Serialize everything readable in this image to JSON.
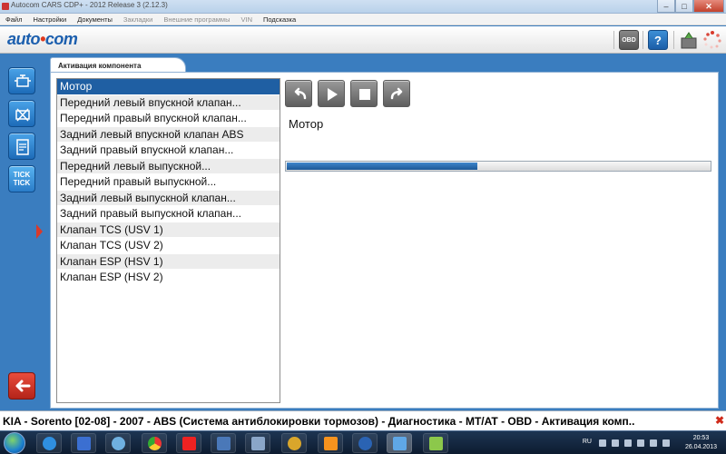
{
  "window": {
    "title": "Autocom CARS CDP+ - 2012 Release 3 (2.12.3)",
    "minimize": "–",
    "maximize": "□",
    "close": "✕"
  },
  "menu": [
    {
      "label": "Файл",
      "enabled": true
    },
    {
      "label": "Настройки",
      "enabled": true
    },
    {
      "label": "Документы",
      "enabled": true
    },
    {
      "label": "Закладки",
      "enabled": false
    },
    {
      "label": "Внешние программы",
      "enabled": false
    },
    {
      "label": "VIN",
      "enabled": false
    },
    {
      "label": "Подсказка",
      "enabled": true
    }
  ],
  "toolbar": {
    "logo_left": "auto",
    "logo_mid": "•",
    "logo_right": "com",
    "obd_label": "OBD",
    "help_label": "?"
  },
  "tab": {
    "label": "Активация компонента"
  },
  "components": [
    {
      "label": "Мотор",
      "selected": true
    },
    {
      "label": "Передний левый впускной клапан..."
    },
    {
      "label": "Передний правый впускной клапан..."
    },
    {
      "label": "Задний левый впускной клапан ABS"
    },
    {
      "label": "Задний правый впускной клапан..."
    },
    {
      "label": "Передний левый выпускной..."
    },
    {
      "label": "Передний правый выпускной..."
    },
    {
      "label": "Задний левый выпускной клапан..."
    },
    {
      "label": "Задний правый выпускной клапан..."
    },
    {
      "label": "Клапан TCS (USV 1)"
    },
    {
      "label": "Клапан TCS (USV 2)"
    },
    {
      "label": "Клапан ESP (HSV 1)"
    },
    {
      "label": "Клапан ESP (HSV 2)"
    }
  ],
  "detail": {
    "component_name": "Мотор",
    "progress": 0.45
  },
  "sidebar": {
    "tick_label": "TICK TICK"
  },
  "status": {
    "text": "KIA - Sorento [02-08] - 2007 - ABS (Система антиблокировки тормозов) - Диагностика - MT/AT - OBD - Активация комп..",
    "close": "✖"
  },
  "taskbar": {
    "lang": "RU",
    "time": "20:53",
    "date": "26.04.2013"
  },
  "colors": {
    "accent": "#1f5fa3",
    "background": "#3a7dbf",
    "back_button": "#d83a2b"
  }
}
